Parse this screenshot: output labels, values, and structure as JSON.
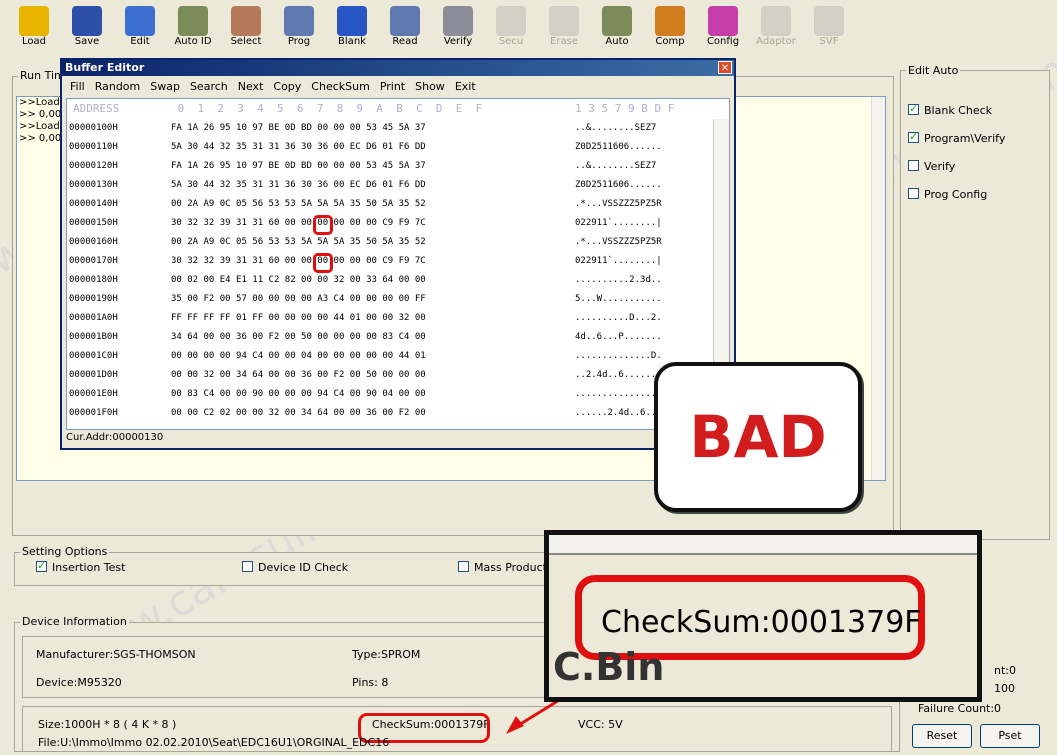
{
  "toolbar": {
    "buttons": [
      {
        "label": "Load",
        "icon": "folder-open-icon",
        "color": "#e8b400",
        "enabled": true
      },
      {
        "label": "Save",
        "icon": "floppy-disk-icon",
        "color": "#2c4fa8",
        "enabled": true
      },
      {
        "label": "Edit",
        "icon": "edit-pen-icon",
        "color": "#3b6fd0",
        "enabled": true
      },
      {
        "label": "Auto ID",
        "icon": "chip-gears-icon",
        "color": "#7b8b59",
        "enabled": true
      },
      {
        "label": "Select",
        "icon": "chip-select-icon",
        "color": "#b47a5a",
        "enabled": true
      },
      {
        "label": "Prog",
        "icon": "chip-arrow-icon",
        "color": "#5f7ab0",
        "enabled": true
      },
      {
        "label": "Blank",
        "icon": "question-chip-icon",
        "color": "#2756c4",
        "enabled": true
      },
      {
        "label": "Read",
        "icon": "chip-read-icon",
        "color": "#5f7ab0",
        "enabled": true
      },
      {
        "label": "Verify",
        "icon": "magnifier-chip-icon",
        "color": "#8d8d9a",
        "enabled": true
      },
      {
        "label": "Secu",
        "icon": "lock-icon",
        "color": "#a9a697",
        "enabled": false
      },
      {
        "label": "Erase",
        "icon": "eraser-chip-icon",
        "color": "#a9a697",
        "enabled": false
      },
      {
        "label": "Auto",
        "icon": "auto-chip-icon",
        "color": "#7b8b59",
        "enabled": true
      },
      {
        "label": "Comp",
        "icon": "compare-icon",
        "color": "#d27c20",
        "enabled": true
      },
      {
        "label": "Config",
        "icon": "config-cubes-icon",
        "color": "#c53ea9",
        "enabled": true
      },
      {
        "label": "Adaptor",
        "icon": "adaptor-icon",
        "color": "#a9a697",
        "enabled": false
      },
      {
        "label": "SVF",
        "icon": "svf-chip-icon",
        "color": "#a9a697",
        "enabled": false
      }
    ]
  },
  "runtime": {
    "label": "Run Tim",
    "lines": [
      ">>Load",
      ">> 0,00",
      ">>Load",
      ">> 0,00"
    ]
  },
  "buffer_editor": {
    "title": "Buffer Editor",
    "menu": [
      "Fill",
      "Random",
      "Swap",
      "Search",
      "Next",
      "Copy",
      "CheckSum",
      "Print",
      "Show",
      "Exit"
    ],
    "header": {
      "address": "ADDRESS",
      "bytes": " 0  1  2  3  4  5  6  7  8  9  A  B  C  D  E  F",
      "ascii": "1 3 5 7 9 B D F"
    },
    "rows": [
      {
        "addr": "00000100H",
        "bytes": "FA 1A 26 95 10 97 BE 0D BD 00 00 00 53 45 5A 37",
        "ascii": "..&........SEZ7"
      },
      {
        "addr": "00000110H",
        "bytes": "5A 30 44 32 35 31 31 36 30 36 00 EC D6 01 F6 DD",
        "ascii": "Z0D2511606......"
      },
      {
        "addr": "00000120H",
        "bytes": "FA 1A 26 95 10 97 BE 0D BD 00 00 00 53 45 5A 37",
        "ascii": "..&........SEZ7"
      },
      {
        "addr": "00000130H",
        "bytes": "5A 30 44 32 35 31 31 36 30 36 00 EC D6 01 F6 DD",
        "ascii": "Z0D2511606......"
      },
      {
        "addr": "00000140H",
        "bytes": "00 2A A9 0C 05 56 53 53 5A 5A 5A 35 50 5A 35 52",
        "ascii": ".*...VSSZZZ5PZ5R"
      },
      {
        "addr": "00000150H",
        "bytes": "30 32 32 39 31 31 60 00 00 00 00 00 00 C9 F9 7C",
        "ascii": "022911`........|"
      },
      {
        "addr": "00000160H",
        "bytes": "00 2A A9 0C 05 56 53 53 5A 5A 5A 35 50 5A 35 52",
        "ascii": ".*...VSSZZZ5PZ5R"
      },
      {
        "addr": "00000170H",
        "bytes": "30 32 32 39 31 31 60 00 00 00 00 00 00 C9 F9 7C",
        "ascii": "022911`........|"
      },
      {
        "addr": "00000180H",
        "bytes": "00 02 00 E4 E1 11 C2 82 00 00 32 00 33 64 00 00",
        "ascii": "..........2.3d.."
      },
      {
        "addr": "00000190H",
        "bytes": "35 00 F2 00 57 00 00 00 00 A3 C4 00 00 00 00 FF",
        "ascii": "5...W..........."
      },
      {
        "addr": "000001A0H",
        "bytes": "FF FF FF FF 01 FF 00 00 00 00 44 01 00 00 32 00",
        "ascii": "..........D...2."
      },
      {
        "addr": "000001B0H",
        "bytes": "34 64 00 00 36 00 F2 00 50 00 00 00 00 83 C4 00",
        "ascii": "4d..6...P......."
      },
      {
        "addr": "000001C0H",
        "bytes": "00 00 00 00 94 C4 00 00 04 00 00 00 00 00 44 01",
        "ascii": "..............D."
      },
      {
        "addr": "000001D0H",
        "bytes": "00 00 32 00 34 64 00 00 36 00 F2 00 50 00 00 00",
        "ascii": "..2.4d..6......."
      },
      {
        "addr": "000001E0H",
        "bytes": "00 83 C4 00 00 90 00 00 00 94 C4 00 90 04 00 00",
        "ascii": "................"
      },
      {
        "addr": "000001F0H",
        "bytes": "00 00 C2 02 00 00 32 00 34 64 00 00 36 00 F2 00",
        "ascii": "......2.4d..6..."
      }
    ],
    "cur_addr": "Cur.Addr:00000130"
  },
  "bad_callout": "BAD",
  "checksum_zoom": {
    "text": "CheckSum:0001379F",
    "tail": "C.Bin"
  },
  "edit_auto": {
    "title": "Edit Auto",
    "options": [
      {
        "label": "Blank Check",
        "checked": true
      },
      {
        "label": "Program\\Verify",
        "checked": true
      },
      {
        "label": "Verify",
        "checked": false
      },
      {
        "label": "Prog Config",
        "checked": false
      }
    ]
  },
  "setting_options": {
    "title": "Setting Options",
    "insertion_test": "Insertion Test",
    "device_id_check": "Device ID Check",
    "mass_production": "Mass Productio"
  },
  "device_info": {
    "title": "Device Information",
    "manufacturer": "Manufacturer:SGS-THOMSON",
    "type": "Type:SPROM",
    "device": "Device:M95320",
    "pins": "Pins: 8",
    "size": "Size:1000H * 8 ( 4 K * 8 )",
    "checksum": "CheckSum:0001379F",
    "vcc": "VCC: 5V",
    "file": "File:U:\\Immo\\Immo 02.02.2010\\Seat\\EDC16U1\\ORGINAL_EDC16"
  },
  "counters": {
    "count_frag": "nt:0",
    "total_frag": "100",
    "failure_count": "Failure Count:0",
    "reset_label": "Reset",
    "pset_label": "Pset"
  },
  "watermark": "www.carecuimmo.com"
}
